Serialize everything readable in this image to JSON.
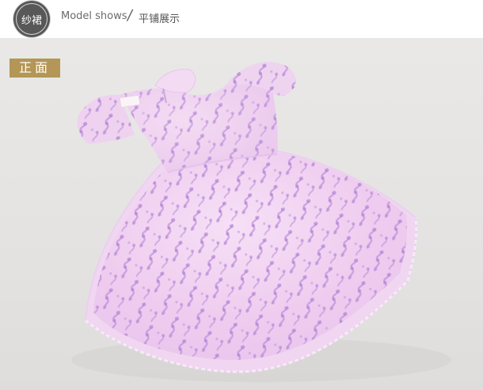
{
  "header": {
    "badge_label": "纱裙",
    "subtitle_en": "Model shows",
    "separator": "/",
    "section_label": "平铺展示"
  },
  "photo": {
    "tag_label": "正面",
    "item": "lavender embroidered organza girls dress, flat lay",
    "colors": {
      "background": "#e6e5e4",
      "dress_base": "#f2d6f0",
      "embroidery": "#b78ad8",
      "tag": "#b49656"
    }
  }
}
